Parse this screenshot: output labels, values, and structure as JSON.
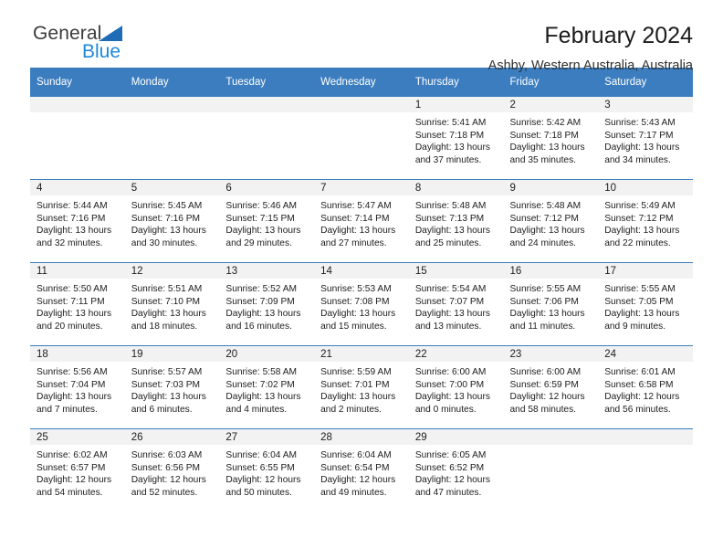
{
  "brand": {
    "name_part1": "General",
    "name_part2": "Blue",
    "triangle_color": "#1e6cb5",
    "blue_color": "#1f87d8"
  },
  "header": {
    "title": "February 2024",
    "location": "Ashby, Western Australia, Australia"
  },
  "theme": {
    "header_bar": "#3b7dbf",
    "daynum_band": "#f2f2f2",
    "text": "#1c1c1c"
  },
  "weekday_headers": [
    "Sunday",
    "Monday",
    "Tuesday",
    "Wednesday",
    "Thursday",
    "Friday",
    "Saturday"
  ],
  "weeks": [
    [
      {
        "day": "",
        "empty": true,
        "sunrise": "",
        "sunset": "",
        "daylight1": "",
        "daylight2": ""
      },
      {
        "day": "",
        "empty": true,
        "sunrise": "",
        "sunset": "",
        "daylight1": "",
        "daylight2": ""
      },
      {
        "day": "",
        "empty": true,
        "sunrise": "",
        "sunset": "",
        "daylight1": "",
        "daylight2": ""
      },
      {
        "day": "",
        "empty": true,
        "sunrise": "",
        "sunset": "",
        "daylight1": "",
        "daylight2": ""
      },
      {
        "day": "1",
        "empty": false,
        "sunrise": "Sunrise: 5:41 AM",
        "sunset": "Sunset: 7:18 PM",
        "daylight1": "Daylight: 13 hours",
        "daylight2": "and 37 minutes."
      },
      {
        "day": "2",
        "empty": false,
        "sunrise": "Sunrise: 5:42 AM",
        "sunset": "Sunset: 7:18 PM",
        "daylight1": "Daylight: 13 hours",
        "daylight2": "and 35 minutes."
      },
      {
        "day": "3",
        "empty": false,
        "sunrise": "Sunrise: 5:43 AM",
        "sunset": "Sunset: 7:17 PM",
        "daylight1": "Daylight: 13 hours",
        "daylight2": "and 34 minutes."
      }
    ],
    [
      {
        "day": "4",
        "empty": false,
        "sunrise": "Sunrise: 5:44 AM",
        "sunset": "Sunset: 7:16 PM",
        "daylight1": "Daylight: 13 hours",
        "daylight2": "and 32 minutes."
      },
      {
        "day": "5",
        "empty": false,
        "sunrise": "Sunrise: 5:45 AM",
        "sunset": "Sunset: 7:16 PM",
        "daylight1": "Daylight: 13 hours",
        "daylight2": "and 30 minutes."
      },
      {
        "day": "6",
        "empty": false,
        "sunrise": "Sunrise: 5:46 AM",
        "sunset": "Sunset: 7:15 PM",
        "daylight1": "Daylight: 13 hours",
        "daylight2": "and 29 minutes."
      },
      {
        "day": "7",
        "empty": false,
        "sunrise": "Sunrise: 5:47 AM",
        "sunset": "Sunset: 7:14 PM",
        "daylight1": "Daylight: 13 hours",
        "daylight2": "and 27 minutes."
      },
      {
        "day": "8",
        "empty": false,
        "sunrise": "Sunrise: 5:48 AM",
        "sunset": "Sunset: 7:13 PM",
        "daylight1": "Daylight: 13 hours",
        "daylight2": "and 25 minutes."
      },
      {
        "day": "9",
        "empty": false,
        "sunrise": "Sunrise: 5:48 AM",
        "sunset": "Sunset: 7:12 PM",
        "daylight1": "Daylight: 13 hours",
        "daylight2": "and 24 minutes."
      },
      {
        "day": "10",
        "empty": false,
        "sunrise": "Sunrise: 5:49 AM",
        "sunset": "Sunset: 7:12 PM",
        "daylight1": "Daylight: 13 hours",
        "daylight2": "and 22 minutes."
      }
    ],
    [
      {
        "day": "11",
        "empty": false,
        "sunrise": "Sunrise: 5:50 AM",
        "sunset": "Sunset: 7:11 PM",
        "daylight1": "Daylight: 13 hours",
        "daylight2": "and 20 minutes."
      },
      {
        "day": "12",
        "empty": false,
        "sunrise": "Sunrise: 5:51 AM",
        "sunset": "Sunset: 7:10 PM",
        "daylight1": "Daylight: 13 hours",
        "daylight2": "and 18 minutes."
      },
      {
        "day": "13",
        "empty": false,
        "sunrise": "Sunrise: 5:52 AM",
        "sunset": "Sunset: 7:09 PM",
        "daylight1": "Daylight: 13 hours",
        "daylight2": "and 16 minutes."
      },
      {
        "day": "14",
        "empty": false,
        "sunrise": "Sunrise: 5:53 AM",
        "sunset": "Sunset: 7:08 PM",
        "daylight1": "Daylight: 13 hours",
        "daylight2": "and 15 minutes."
      },
      {
        "day": "15",
        "empty": false,
        "sunrise": "Sunrise: 5:54 AM",
        "sunset": "Sunset: 7:07 PM",
        "daylight1": "Daylight: 13 hours",
        "daylight2": "and 13 minutes."
      },
      {
        "day": "16",
        "empty": false,
        "sunrise": "Sunrise: 5:55 AM",
        "sunset": "Sunset: 7:06 PM",
        "daylight1": "Daylight: 13 hours",
        "daylight2": "and 11 minutes."
      },
      {
        "day": "17",
        "empty": false,
        "sunrise": "Sunrise: 5:55 AM",
        "sunset": "Sunset: 7:05 PM",
        "daylight1": "Daylight: 13 hours",
        "daylight2": "and 9 minutes."
      }
    ],
    [
      {
        "day": "18",
        "empty": false,
        "sunrise": "Sunrise: 5:56 AM",
        "sunset": "Sunset: 7:04 PM",
        "daylight1": "Daylight: 13 hours",
        "daylight2": "and 7 minutes."
      },
      {
        "day": "19",
        "empty": false,
        "sunrise": "Sunrise: 5:57 AM",
        "sunset": "Sunset: 7:03 PM",
        "daylight1": "Daylight: 13 hours",
        "daylight2": "and 6 minutes."
      },
      {
        "day": "20",
        "empty": false,
        "sunrise": "Sunrise: 5:58 AM",
        "sunset": "Sunset: 7:02 PM",
        "daylight1": "Daylight: 13 hours",
        "daylight2": "and 4 minutes."
      },
      {
        "day": "21",
        "empty": false,
        "sunrise": "Sunrise: 5:59 AM",
        "sunset": "Sunset: 7:01 PM",
        "daylight1": "Daylight: 13 hours",
        "daylight2": "and 2 minutes."
      },
      {
        "day": "22",
        "empty": false,
        "sunrise": "Sunrise: 6:00 AM",
        "sunset": "Sunset: 7:00 PM",
        "daylight1": "Daylight: 13 hours",
        "daylight2": "and 0 minutes."
      },
      {
        "day": "23",
        "empty": false,
        "sunrise": "Sunrise: 6:00 AM",
        "sunset": "Sunset: 6:59 PM",
        "daylight1": "Daylight: 12 hours",
        "daylight2": "and 58 minutes."
      },
      {
        "day": "24",
        "empty": false,
        "sunrise": "Sunrise: 6:01 AM",
        "sunset": "Sunset: 6:58 PM",
        "daylight1": "Daylight: 12 hours",
        "daylight2": "and 56 minutes."
      }
    ],
    [
      {
        "day": "25",
        "empty": false,
        "sunrise": "Sunrise: 6:02 AM",
        "sunset": "Sunset: 6:57 PM",
        "daylight1": "Daylight: 12 hours",
        "daylight2": "and 54 minutes."
      },
      {
        "day": "26",
        "empty": false,
        "sunrise": "Sunrise: 6:03 AM",
        "sunset": "Sunset: 6:56 PM",
        "daylight1": "Daylight: 12 hours",
        "daylight2": "and 52 minutes."
      },
      {
        "day": "27",
        "empty": false,
        "sunrise": "Sunrise: 6:04 AM",
        "sunset": "Sunset: 6:55 PM",
        "daylight1": "Daylight: 12 hours",
        "daylight2": "and 50 minutes."
      },
      {
        "day": "28",
        "empty": false,
        "sunrise": "Sunrise: 6:04 AM",
        "sunset": "Sunset: 6:54 PM",
        "daylight1": "Daylight: 12 hours",
        "daylight2": "and 49 minutes."
      },
      {
        "day": "29",
        "empty": false,
        "sunrise": "Sunrise: 6:05 AM",
        "sunset": "Sunset: 6:52 PM",
        "daylight1": "Daylight: 12 hours",
        "daylight2": "and 47 minutes."
      },
      {
        "day": "",
        "empty": true,
        "sunrise": "",
        "sunset": "",
        "daylight1": "",
        "daylight2": ""
      },
      {
        "day": "",
        "empty": true,
        "sunrise": "",
        "sunset": "",
        "daylight1": "",
        "daylight2": ""
      }
    ]
  ]
}
